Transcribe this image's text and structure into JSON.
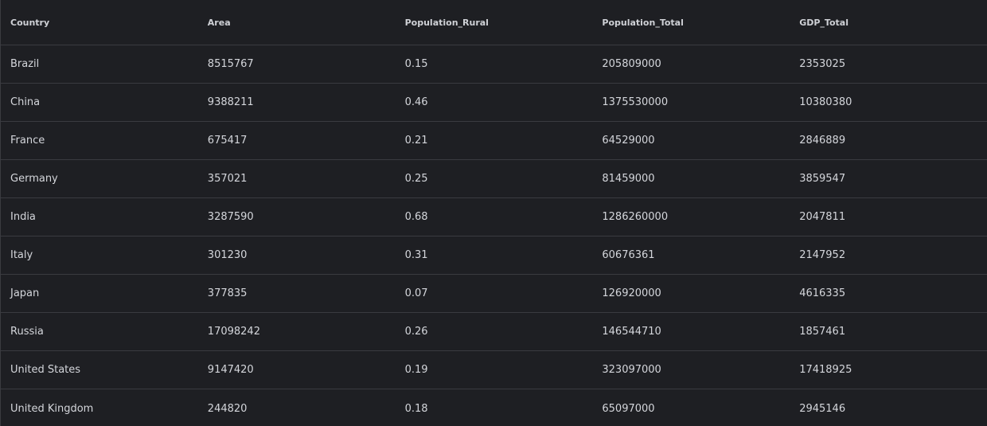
{
  "table": {
    "columns": [
      "Country",
      "Area",
      "Population_Rural",
      "Population_Total",
      "GDP_Total"
    ],
    "rows": [
      [
        "Brazil",
        "8515767",
        "0.15",
        "205809000",
        "2353025"
      ],
      [
        "China",
        "9388211",
        "0.46",
        "1375530000",
        "10380380"
      ],
      [
        "France",
        "675417",
        "0.21",
        "64529000",
        "2846889"
      ],
      [
        "Germany",
        "357021",
        "0.25",
        "81459000",
        "3859547"
      ],
      [
        "India",
        "3287590",
        "0.68",
        "1286260000",
        "2047811"
      ],
      [
        "Italy",
        "301230",
        "0.31",
        "60676361",
        "2147952"
      ],
      [
        "Japan",
        "377835",
        "0.07",
        "126920000",
        "4616335"
      ],
      [
        "Russia",
        "17098242",
        "0.26",
        "146544710",
        "1857461"
      ],
      [
        "United States",
        "9147420",
        "0.19",
        "323097000",
        "17418925"
      ],
      [
        "United Kingdom",
        "244820",
        "0.18",
        "65097000",
        "2945146"
      ]
    ]
  },
  "colors": {
    "background": "#1e1f23",
    "border": "#3a3b40",
    "text": "#d4d6db"
  }
}
